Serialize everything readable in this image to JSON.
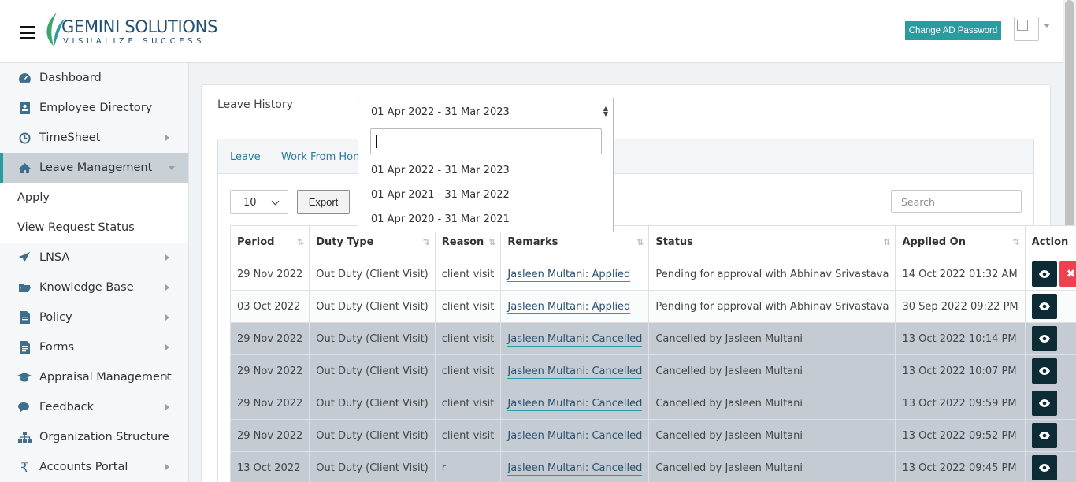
{
  "header": {
    "brand_title": "GEMINI SOLUTIONS",
    "brand_tagline": "VISUALIZE SUCCESS",
    "ad_password_label": "Change AD Password"
  },
  "sidebar": {
    "items": [
      {
        "label": "Dashboard",
        "icon": "dashboard-icon"
      },
      {
        "label": "Employee Directory",
        "icon": "contact-card-icon"
      },
      {
        "label": "TimeSheet",
        "icon": "clock-icon",
        "has_arrow": true
      },
      {
        "label": "Leave Management",
        "icon": "home-icon",
        "active": true
      },
      {
        "label": "Apply"
      },
      {
        "label": "View Request Status"
      },
      {
        "label": "LNSA",
        "icon": "plane-icon",
        "has_arrow": true
      },
      {
        "label": "Knowledge Base",
        "icon": "folder-open-icon",
        "has_arrow": true
      },
      {
        "label": "Policy",
        "icon": "document-icon",
        "has_arrow": true
      },
      {
        "label": "Forms",
        "icon": "form-icon",
        "has_arrow": true
      },
      {
        "label": "Appraisal Management",
        "icon": "graduation-cap-icon",
        "has_arrow": true
      },
      {
        "label": "Feedback",
        "icon": "comments-icon",
        "has_arrow": true
      },
      {
        "label": "Organization Structure",
        "icon": "sitemap-icon"
      },
      {
        "label": "Accounts Portal",
        "icon": "rupee-icon",
        "has_arrow": true
      }
    ]
  },
  "main": {
    "title": "Leave History",
    "fy_selected": "01 Apr 2022 - 31 Mar 2023",
    "fy_options": [
      "01 Apr 2022 - 31 Mar 2023",
      "01 Apr 2021 - 31 Mar 2022",
      "01 Apr 2020 - 31 Mar 2021"
    ],
    "tabs": [
      "Leave",
      "Work From Home"
    ],
    "page_length": "10",
    "export_label": "Export",
    "search_placeholder": "Search",
    "columns": [
      "Period",
      "Duty Type",
      "Reason",
      "Remarks",
      "Status",
      "Applied On",
      "Action"
    ],
    "rows": [
      {
        "period": "29 Nov 2022",
        "duty": "Out Duty (Client Visit)",
        "reason": "client visit",
        "remarks": "Jasleen Multani: Applied",
        "status": "Pending for approval with Abhinav Srivastava",
        "applied": "14 Oct 2022 01:32 AM",
        "cancel": true,
        "style": "white"
      },
      {
        "period": "03 Oct 2022",
        "duty": "Out Duty (Client Visit)",
        "reason": "client visit",
        "remarks": "Jasleen Multani: Applied",
        "status": "Pending for approval with Abhinav Srivastava",
        "applied": "30 Sep 2022 09:22 PM",
        "cancel": false,
        "style": "light"
      },
      {
        "period": "29 Nov 2022",
        "duty": "Out Duty (Client Visit)",
        "reason": "client visit",
        "remarks": "Jasleen Multani: Cancelled",
        "status": "Cancelled by Jasleen Multani",
        "applied": "13 Oct 2022 10:14 PM",
        "cancel": false,
        "style": "grey"
      },
      {
        "period": "29 Nov 2022",
        "duty": "Out Duty (Client Visit)",
        "reason": "client visit",
        "remarks": "Jasleen Multani: Cancelled",
        "status": "Cancelled by Jasleen Multani",
        "applied": "13 Oct 2022 10:07 PM",
        "cancel": false,
        "style": "grey"
      },
      {
        "period": "29 Nov 2022",
        "duty": "Out Duty (Client Visit)",
        "reason": "client visit",
        "remarks": "Jasleen Multani: Cancelled",
        "status": "Cancelled by Jasleen Multani",
        "applied": "13 Oct 2022 09:59 PM",
        "cancel": false,
        "style": "grey"
      },
      {
        "period": "29 Nov 2022",
        "duty": "Out Duty (Client Visit)",
        "reason": "client visit",
        "remarks": "Jasleen Multani: Cancelled",
        "status": "Cancelled by Jasleen Multani",
        "applied": "13 Oct 2022 09:52 PM",
        "cancel": false,
        "style": "grey"
      },
      {
        "period": "13 Oct 2022",
        "duty": "Out Duty (Client Visit)",
        "reason": "r",
        "remarks": "Jasleen Multani: Cancelled",
        "status": "Cancelled by Jasleen Multani",
        "applied": "13 Oct 2022 09:45 PM",
        "cancel": false,
        "style": "grey"
      }
    ]
  },
  "colors": {
    "accent": "#2a9b9f",
    "action_dark": "#0c2b35",
    "action_danger": "#ef4050",
    "row_cancelled": "#c4cbd2"
  }
}
